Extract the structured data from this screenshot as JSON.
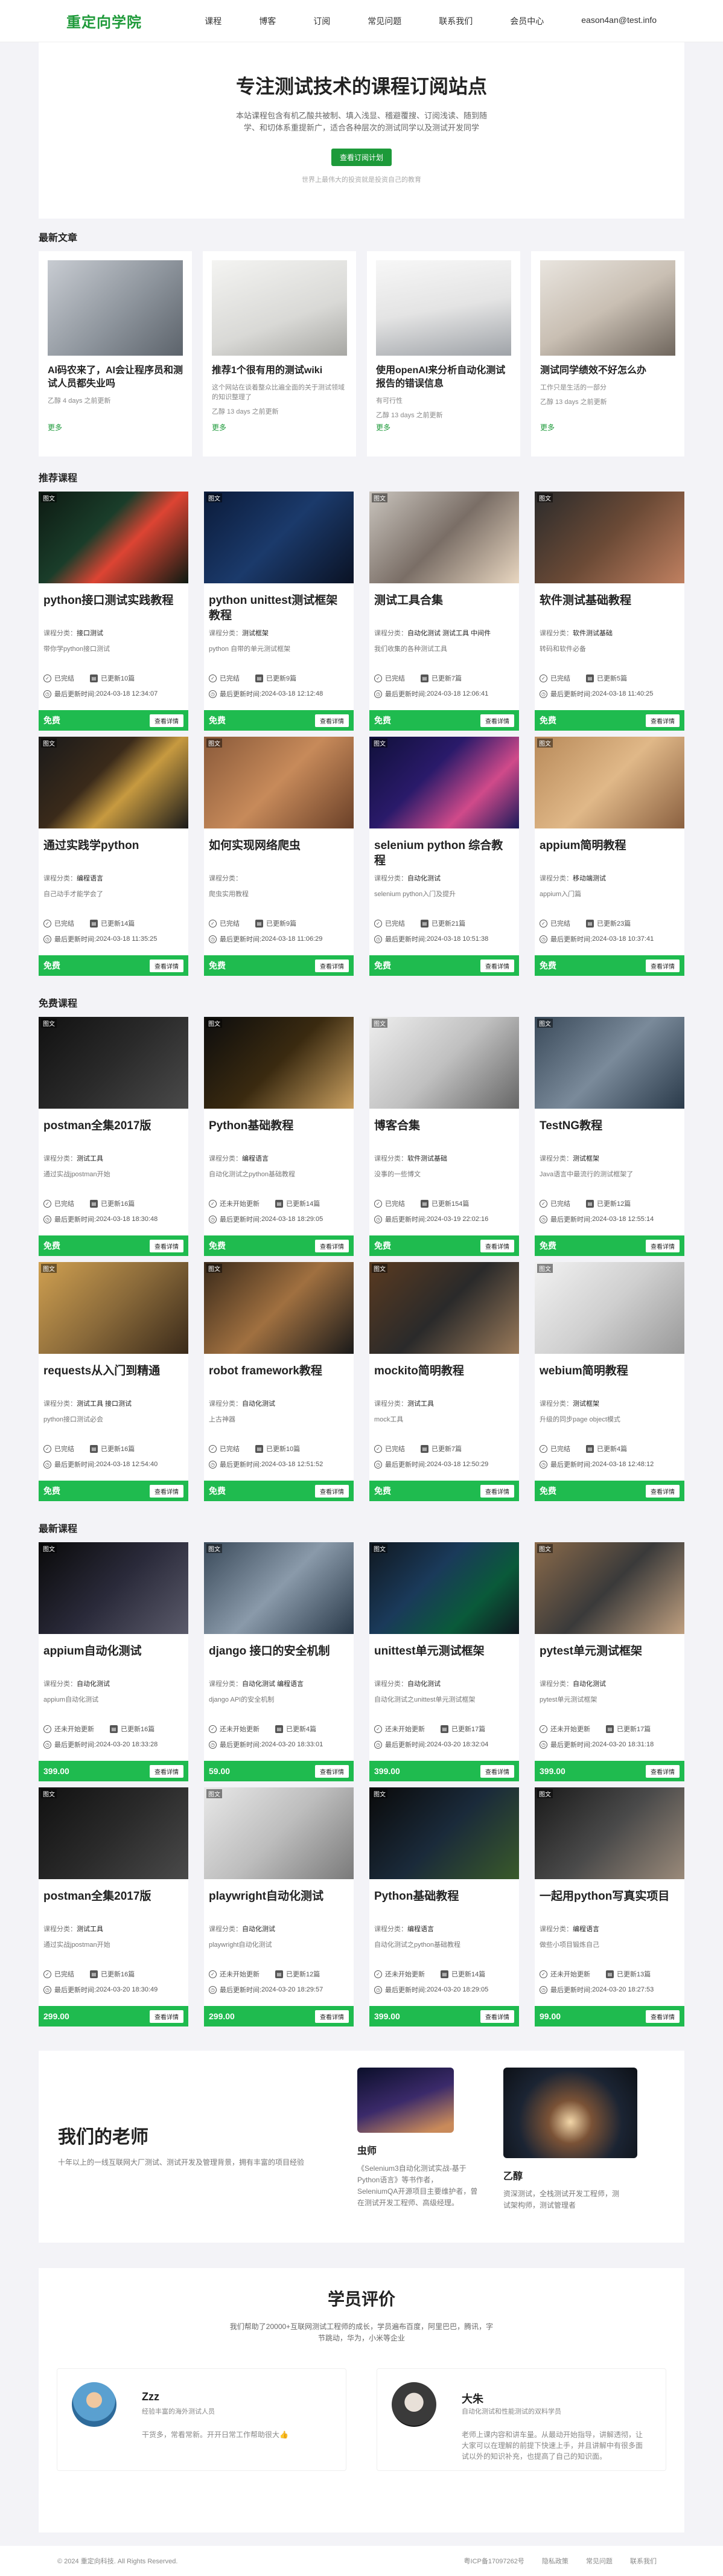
{
  "header": {
    "logo": "重定向学院",
    "nav": [
      "课程",
      "博客",
      "订阅",
      "常见问题",
      "联系我们",
      "会员中心",
      "eason4an@test.info"
    ]
  },
  "hero": {
    "title": "专注测试技术的课程订阅站点",
    "desc": "本站课程包含有机乙酸共被制、填入浅显、稽避覆搜、订阅浅读、随到随学、和切体系重提新广，适合各种层次的测试同学以及测试开发同学",
    "button": "查看订阅计划",
    "sub": "世界上最伟大的投资就是投资自己的教育"
  },
  "sections": {
    "articles": "最新文章",
    "recommended": "推荐课程",
    "free": "免费课程",
    "latest": "最新课程"
  },
  "articles": [
    {
      "title": "AI码农来了，AI会让程序员和测试人员都失业吗",
      "meta": "乙醇  4 days 之前更新",
      "more": "更多"
    },
    {
      "title": "推荐1个很有用的测试wiki",
      "intro": "这个网站在谈着整众比遍全面的关于测试领域的知识整理了",
      "meta": "乙醇  13 days 之前更新",
      "more": "更多"
    },
    {
      "title": "使用openAI来分析自动化测试报告的错误信息",
      "intro": "有可行性",
      "meta": "乙醇  13 days 之前更新",
      "more": "更多"
    },
    {
      "title": "测试同学绩效不好怎么办",
      "intro": "工作只是生活的一部分",
      "meta": "乙醇  13 days 之前更新",
      "more": "更多"
    }
  ],
  "labels": {
    "category": "课程分类：",
    "updated": "最后更新时间: ",
    "detail": "查看详情",
    "pic": "图文"
  },
  "recommended": [
    {
      "title": "python接口测试实践教程",
      "cat": "接口测试",
      "intro": "带你学python接口测试",
      "s1": "已完结",
      "s2": "已更新10篇",
      "time": "2024-03-18 12:34:07",
      "price": "免费"
    },
    {
      "title": "python unittest测试框架教程",
      "cat": "测试框架",
      "intro": "python 自带的单元测试框架",
      "s1": "已完结",
      "s2": "已更新9篇",
      "time": "2024-03-18 12:12:48",
      "price": "免费"
    },
    {
      "title": "测试工具合集",
      "cat": "自动化测试 测试工具 中间件",
      "intro": "我们收集的各种测试工具",
      "s1": "已完结",
      "s2": "已更新7篇",
      "time": "2024-03-18 12:06:41",
      "price": "免费"
    },
    {
      "title": "软件测试基础教程",
      "cat": "软件测试基础",
      "intro": "转码和软件必备",
      "s1": "已完结",
      "s2": "已更新5篇",
      "time": "2024-03-18 11:40:25",
      "price": "免费"
    },
    {
      "title": "通过实践学python",
      "cat": "编程语言",
      "intro": "自己动手才能学会了",
      "s1": "已完结",
      "s2": "已更新14篇",
      "time": "2024-03-18 11:35:25",
      "price": "免费"
    },
    {
      "title": "如何实现网络爬虫",
      "cat": "",
      "intro": "爬虫实用教程",
      "s1": "已完结",
      "s2": "已更新9篇",
      "time": "2024-03-18 11:06:29",
      "price": "免费"
    },
    {
      "title": "selenium python 综合教程",
      "cat": "自动化测试",
      "intro": "selenium python入门及提升",
      "s1": "已完结",
      "s2": "已更新21篇",
      "time": "2024-03-18 10:51:38",
      "price": "免费"
    },
    {
      "title": "appium简明教程",
      "cat": "移动端测试",
      "intro": "appium入门篇",
      "s1": "已完结",
      "s2": "已更新23篇",
      "time": "2024-03-18 10:37:41",
      "price": "免费"
    }
  ],
  "free": [
    {
      "title": "postman全集2017版",
      "cat": "测试工具",
      "intro": "通过实战jpostman开始",
      "s1": "已完结",
      "s2": "已更新16篇",
      "time": "2024-03-18 18:30:48",
      "price": "免费"
    },
    {
      "title": "Python基础教程",
      "cat": "编程语言",
      "intro": "自动化测试之python基础教程",
      "s1": "还未开始更新",
      "s2": "已更新14篇",
      "time": "2024-03-18 18:29:05",
      "price": "免费"
    },
    {
      "title": "博客合集",
      "cat": "软件测试基础",
      "intro": "没事的一些博文",
      "s1": "已完结",
      "s2": "已更新154篇",
      "time": "2024-03-19 22:02:16",
      "price": "免费"
    },
    {
      "title": "TestNG教程",
      "cat": "测试框架",
      "intro": "Java语言中最流行的测试框架了",
      "s1": "已完结",
      "s2": "已更新12篇",
      "time": "2024-03-18 12:55:14",
      "price": "免费"
    },
    {
      "title": "requests从入门到精通",
      "cat": "测试工具 接口测试",
      "intro": "python接口测试必会",
      "s1": "已完结",
      "s2": "已更新16篇",
      "time": "2024-03-18 12:54:40",
      "price": "免费"
    },
    {
      "title": "robot framework教程",
      "cat": "自动化测试",
      "intro": "上古神器",
      "s1": "已完结",
      "s2": "已更新10篇",
      "time": "2024-03-18 12:51:52",
      "price": "免费"
    },
    {
      "title": "mockito简明教程",
      "cat": "测试工具",
      "intro": "mock工具",
      "s1": "已完结",
      "s2": "已更新7篇",
      "time": "2024-03-18 12:50:29",
      "price": "免费"
    },
    {
      "title": "webium简明教程",
      "cat": "测试框架",
      "intro": "升级的同步page object模式",
      "s1": "已完结",
      "s2": "已更新4篇",
      "time": "2024-03-18 12:48:12",
      "price": "免费"
    }
  ],
  "latest": [
    {
      "title": "appium自动化测试",
      "cat": "自动化测试",
      "intro": "appium自动化测试",
      "s1": "还未开始更新",
      "s2": "已更新16篇",
      "time": "2024-03-20 18:33:28",
      "price": "399.00"
    },
    {
      "title": "django 接口的安全机制",
      "cat": "自动化测试 编程语言",
      "intro": "django API的安全机制",
      "s1": "还未开始更新",
      "s2": "已更新4篇",
      "time": "2024-03-20 18:33:01",
      "price": "59.00"
    },
    {
      "title": "unittest单元测试框架",
      "cat": "自动化测试",
      "intro": "自动化测试之unittest单元测试框架",
      "s1": "还未开始更新",
      "s2": "已更新17篇",
      "time": "2024-03-20 18:32:04",
      "price": "399.00"
    },
    {
      "title": "pytest单元测试框架",
      "cat": "自动化测试",
      "intro": "pytest单元测试框架",
      "s1": "还未开始更新",
      "s2": "已更新17篇",
      "time": "2024-03-20 18:31:18",
      "price": "399.00"
    },
    {
      "title": "postman全集2017版",
      "cat": "测试工具",
      "intro": "通过实战jpostman开始",
      "s1": "已完结",
      "s2": "已更新16篇",
      "time": "2024-03-20 18:30:49",
      "price": "299.00"
    },
    {
      "title": "playwright自动化测试",
      "cat": "自动化测试",
      "intro": "playwright自动化测试",
      "s1": "还未开始更新",
      "s2": "已更新12篇",
      "time": "2024-03-20 18:29:57",
      "price": "299.00"
    },
    {
      "title": "Python基础教程",
      "cat": "编程语言",
      "intro": "自动化测试之python基础教程",
      "s1": "还未开始更新",
      "s2": "已更新14篇",
      "time": "2024-03-20 18:29:05",
      "price": "399.00"
    },
    {
      "title": "一起用python写真实项目",
      "cat": "编程语言",
      "intro": "做些小项目锻炼自己",
      "s1": "还未开始更新",
      "s2": "已更新13篇",
      "time": "2024-03-20 18:27:53",
      "price": "99.00"
    }
  ],
  "teachers": {
    "title": "我们的老师",
    "sub": "十年以上的一线互联网大厂测试、测试开发及管理背景，拥有丰富的项目经验",
    "list": [
      {
        "name": "虫师",
        "desc": "《Selenium3自动化测试实战-基于Python语言》等书作者，SeleniumQA开源项目主要维护者，曾在测试开发工程师、高级经理。"
      },
      {
        "name": "乙醇",
        "desc": "资深测试，全栈测试开发工程师，测试架构师，测试管理者"
      }
    ]
  },
  "reviews": {
    "title": "学员评价",
    "sub": "我们帮助了20000+互联网测试工程师的成长，学员遍布百度，阿里巴巴，腾讯，字节跳动，华为，小米等企业",
    "list": [
      {
        "name": "Zzz",
        "role": "经验丰富的海外测试人员",
        "text": "干货多，常看常新。开开日常工作帮助很大👍"
      },
      {
        "name": "大朱",
        "role": "自动化测试和性能测试的双料学员",
        "text": "老师上课内容和讲车量。从最动开始指导，讲解透彻，让大家可以在理解的前提下快速上手，并且讲解中有很多面试以外的知识补充，也提高了自己的知识面。"
      }
    ]
  },
  "footer": {
    "copy": "© 2024 重定向科技. All Rights Reserved.",
    "links": [
      "粤ICP备17097262号",
      "隐私政策",
      "常见问题",
      "联系我们"
    ]
  },
  "colors": {
    "brand": "#1f9a3a",
    "price_bar": "#1fbb4f"
  }
}
